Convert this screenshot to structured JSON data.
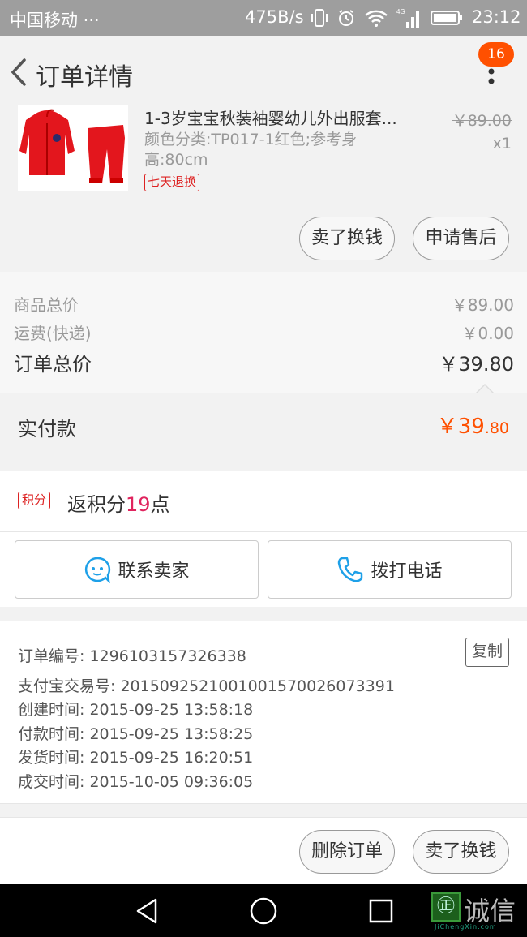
{
  "status_bar": {
    "carrier": "中国移动 ···",
    "net_speed": "475B/s",
    "time": "23:12",
    "icons": [
      "vibrate-icon",
      "alarm-icon",
      "wifi-icon",
      "4g-signal-icon",
      "battery-icon"
    ]
  },
  "header": {
    "title": "订单详情",
    "badge_count": "16"
  },
  "product": {
    "title": "1-3岁宝宝秋装袖婴幼儿外出服套...",
    "spec": "颜色分类:TP017-1红色;参考身高:80cm",
    "return_tag": "七天退换",
    "original_price": "￥89.00",
    "quantity": "x1",
    "actions": [
      "卖了换钱",
      "申请售后"
    ]
  },
  "price_summary": {
    "goods_total_label": "商品总价",
    "goods_total_value": "￥89.00",
    "shipping_label": "运费(快递)",
    "shipping_value": "￥0.00",
    "order_total_label": "订单总价",
    "order_total_value": "￥39.80"
  },
  "payment": {
    "label": "实付款",
    "currency": "￥",
    "amount_main": "39",
    "amount_cents": ".80"
  },
  "points": {
    "tag": "积分",
    "prefix": "返积分",
    "count": "19",
    "suffix": "点"
  },
  "contact": {
    "seller_label": "联系卖家",
    "call_label": "拨打电话"
  },
  "order_info": {
    "order_no": "订单编号: 1296103157326338",
    "copy_label": "复制",
    "alipay_no": "支付宝交易号: 2015092521001001570026073391",
    "created": "创建时间: 2015-09-25 13:58:18",
    "paid": "付款时间: 2015-09-25 13:58:25",
    "shipped": "发货时间: 2015-09-25 16:20:51",
    "completed": "成交时间: 2015-10-05 09:36:05"
  },
  "bottom_actions": [
    "删除订单",
    "卖了换钱"
  ],
  "watermark": {
    "glyph": "㊣",
    "text": "诚信",
    "url": "JiChengXin.com"
  },
  "colors": {
    "accent": "#ff5000",
    "points_number": "#e0245e",
    "tag_red": "#dd2222",
    "status_bar": "#9e9e9e"
  }
}
